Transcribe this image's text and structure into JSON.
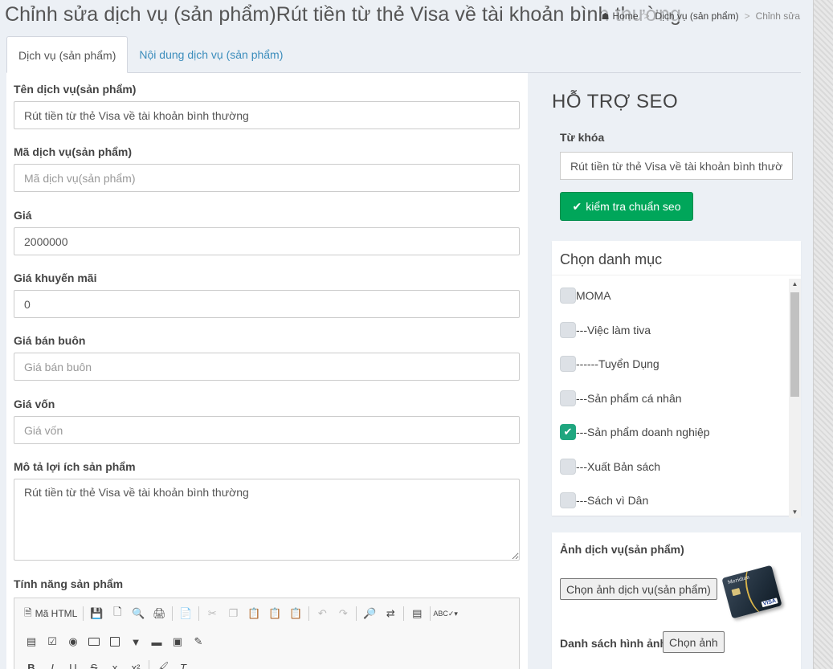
{
  "page_title": "Chỉnh sửa dịch vụ (sản phẩm)Rút tiền từ thẻ Visa về tài khoản bình thường",
  "breadcrumb": {
    "home": "Home",
    "section": "Dịch vụ (sản phẩm)",
    "current": "Chỉnh sửa"
  },
  "tabs": [
    {
      "label": "Dịch vụ (sản phẩm)",
      "active": true
    },
    {
      "label": "Nội dung dịch vụ (sản phẩm)",
      "active": false
    }
  ],
  "form": {
    "name": {
      "label": "Tên dịch vụ(sản phẩm)",
      "value": "Rút tiền từ thẻ Visa về tài khoản bình thường",
      "placeholder": ""
    },
    "code": {
      "label": "Mã dịch vụ(sản phẩm)",
      "value": "",
      "placeholder": "Mã dịch vụ(sản phẩm)"
    },
    "price": {
      "label": "Giá",
      "value": "2000000",
      "placeholder": ""
    },
    "sale_price": {
      "label": "Giá khuyến mãi",
      "value": "0",
      "placeholder": ""
    },
    "wholesale": {
      "label": "Giá bán buôn",
      "value": "",
      "placeholder": "Giá bán buôn"
    },
    "cost": {
      "label": "Giá vốn",
      "value": "",
      "placeholder": "Giá vốn"
    },
    "benefit": {
      "label": "Mô tả lợi ích sản phẩm",
      "value": "Rút tiền từ thẻ Visa về tài khoản bình thường"
    },
    "features": {
      "label": "Tính năng sản phẩm"
    }
  },
  "editor": {
    "html_label": "Mã HTML",
    "format_b": "B",
    "format_i": "I",
    "format_u": "U",
    "format_s": "S",
    "format_sub": "x",
    "format_sup": "x²",
    "format_clear": "T",
    "spell_label": "ABC"
  },
  "seo": {
    "title": "HỖ TRỢ SEO",
    "keyword_label": "Từ khóa",
    "keyword_value": "Rút tiền từ thẻ Visa về tài khoản bình thường",
    "check_button": "kiểm tra chuẩn seo"
  },
  "categories": {
    "title": "Chọn danh mục",
    "items": [
      {
        "label": "MOMA",
        "checked": false
      },
      {
        "label": "---Việc làm tiva",
        "checked": false
      },
      {
        "label": "------Tuyển Dụng",
        "checked": false
      },
      {
        "label": "---Sản phẩm cá nhân",
        "checked": false
      },
      {
        "label": "---Sản phẩm doanh nghiệp",
        "checked": true
      },
      {
        "label": "---Xuất Bản sách",
        "checked": false
      },
      {
        "label": "---Sách vì Dân",
        "checked": false
      }
    ]
  },
  "images": {
    "label": "Ảnh dịch vụ(sản phẩm)",
    "choose_button": "Chọn ảnh dịch vụ(sản phẩm)",
    "list_label": "Danh sách hình ảnh",
    "list_button": "Chọn ảnh",
    "card_brand": "Meridian",
    "card_logo": "VISA"
  },
  "colors": {
    "accent": "#3c8dbc",
    "success": "#00a65a",
    "checkbox_checked": "#1fa67f"
  }
}
